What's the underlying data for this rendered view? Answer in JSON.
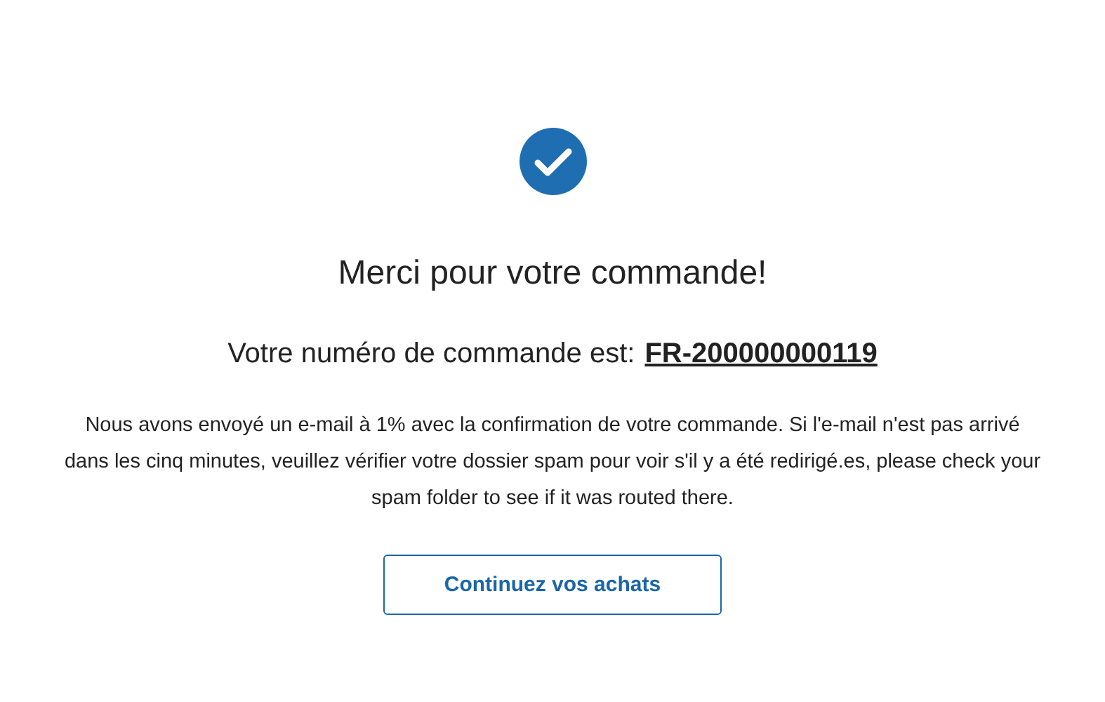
{
  "confirmation": {
    "title": "Merci pour votre commande!",
    "order_label": "Votre numéro de commande est:",
    "order_number": "FR-200000000119",
    "message": "Nous avons envoyé un e-mail à 1% avec la confirmation de votre commande. Si l'e-mail n'est pas arrivé dans les cinq minutes, veuillez vérifier votre dossier spam pour voir s'il y a été redirigé.es, please check your spam folder to see if it was routed there.",
    "button": "Continuez vos achats"
  }
}
